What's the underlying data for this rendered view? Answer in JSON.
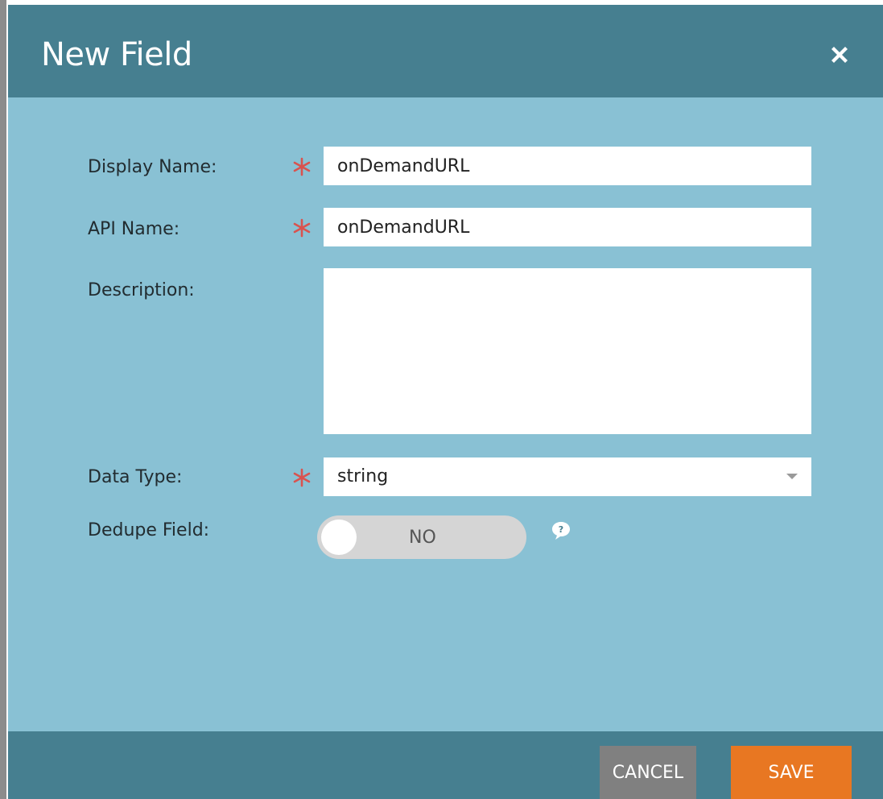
{
  "dialog": {
    "title": "New Field",
    "close_icon": "close-icon"
  },
  "form": {
    "display_name": {
      "label": "Display Name:",
      "value": "onDemandURL",
      "required": true
    },
    "api_name": {
      "label": "API Name:",
      "value": "onDemandURL",
      "required": true
    },
    "description": {
      "label": "Description:",
      "value": ""
    },
    "data_type": {
      "label": "Data Type:",
      "value": "string",
      "required": true
    },
    "dedupe_field": {
      "label": "Dedupe Field:",
      "value": "NO",
      "help_icon": "help-bubble-icon"
    }
  },
  "footer": {
    "cancel_label": "CANCEL",
    "save_label": "SAVE"
  },
  "colors": {
    "header": "#467f90",
    "body": "#89c1d4",
    "required_marker": "#d9534f",
    "save_button": "#e87722",
    "cancel_button": "#808080"
  }
}
